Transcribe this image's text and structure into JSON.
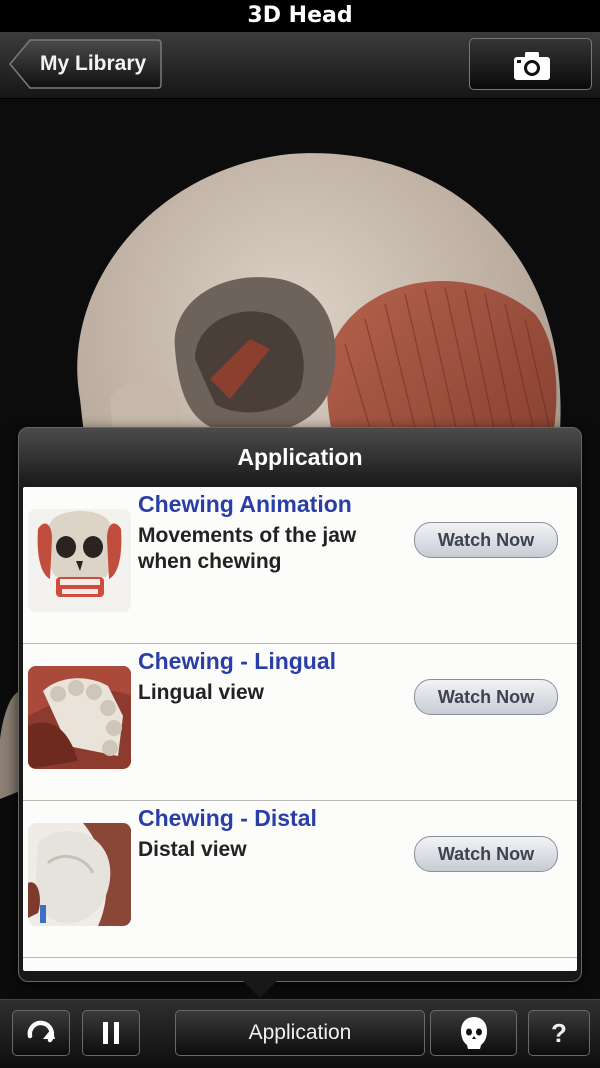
{
  "status_bar": {
    "title": "3D Head"
  },
  "nav": {
    "back_label": "My Library",
    "camera_icon": "camera-icon"
  },
  "popup": {
    "title": "Application",
    "items": [
      {
        "title": "Chewing Animation",
        "description": "Movements of the jaw when chewing",
        "button": "Watch Now",
        "thumb": "skull-thumbnail"
      },
      {
        "title": "Chewing - Lingual",
        "description": "Lingual view",
        "button": "Watch Now",
        "thumb": "teeth-thumbnail"
      },
      {
        "title": "Chewing - Distal",
        "description": "Distal view",
        "button": "Watch Now",
        "thumb": "molar-thumbnail"
      }
    ]
  },
  "toolbar": {
    "rotate_icon": "rotate-icon",
    "pause_icon": "pause-icon",
    "application_label": "Application",
    "head_icon": "head-icon",
    "help_label": "?"
  },
  "colors": {
    "title_blue": "#2a3ea8",
    "bar_dark": "#161616",
    "muscle": "#a0523f",
    "bone": "#cfc2b4"
  }
}
